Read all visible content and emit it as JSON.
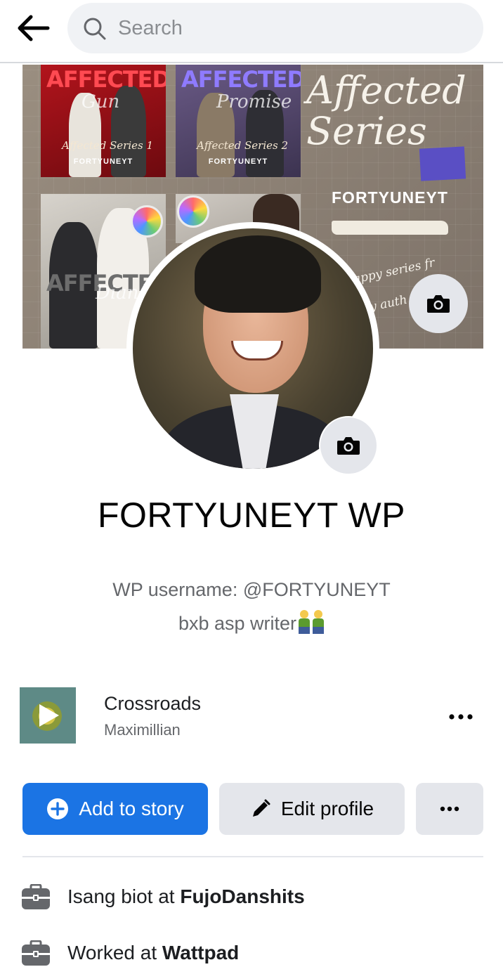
{
  "search": {
    "placeholder": "Search"
  },
  "cover": {
    "books": [
      {
        "title": "AFFECTED",
        "subtitle": "Gun",
        "series": "Affected Series 1",
        "author": "FORTYUNEYT"
      },
      {
        "title": "AFFECTED",
        "subtitle": "Promise",
        "series": "Affected Series 2",
        "author": "FORTYUNEYT"
      },
      {
        "title": "AFFECTED",
        "subtitle": "Diane"
      }
    ],
    "script_title": "Affected Series",
    "author": "FORTYUNEYT",
    "tagline": "appy series fr",
    "tagline2": "y auth"
  },
  "profile": {
    "name": "FORTYUNEYT WP",
    "bio_line1": "WP username: @FORTYUNEYT",
    "bio_line2": "bxb asp writer"
  },
  "music": {
    "title": "Crossroads",
    "artist": "Maximillian"
  },
  "actions": {
    "add_story": "Add to story",
    "edit_profile": "Edit profile"
  },
  "intro": [
    {
      "prefix": "Isang biot at ",
      "place": "FujoDanshits"
    },
    {
      "prefix": "Worked at ",
      "place": "Wattpad"
    }
  ],
  "colors": {
    "primary": "#1b74e4",
    "secondary_button": "#e4e6eb",
    "search_bg": "#f0f2f5",
    "muted_text": "#65676b"
  },
  "icons": [
    "back-arrow-icon",
    "search-icon",
    "camera-icon",
    "play-icon",
    "more-icon",
    "plus-circle-icon",
    "pencil-icon",
    "briefcase-icon"
  ]
}
